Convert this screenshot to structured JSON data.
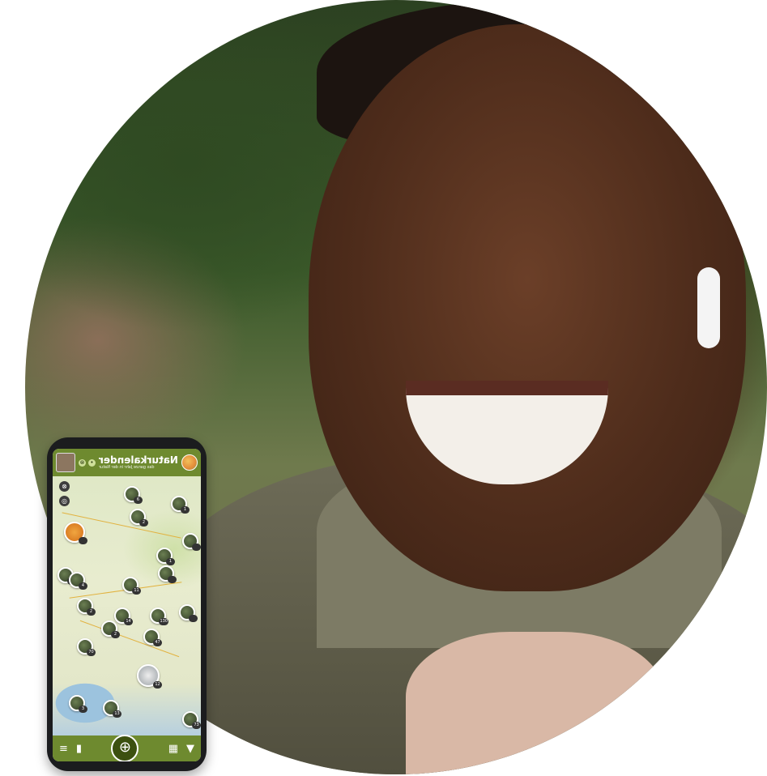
{
  "app": {
    "title": "Naturkalender",
    "subtitle": "das ganze Jahr in der Natur"
  },
  "colors": {
    "brand_green": "#6e8a2f",
    "brand_dark": "#3c5010",
    "phone_body": "#1b1c1e"
  },
  "icons": {
    "menu": "≡",
    "stats": "▮",
    "add": "⊕",
    "grid": "▦",
    "filter": "▼",
    "locate": "◎",
    "binoculars": "⊗",
    "bell": "•"
  },
  "map_markers": [
    {
      "count": "6"
    },
    {
      "count": "1"
    },
    {
      "count": "2"
    },
    {
      "count": ""
    },
    {
      "count": "1"
    },
    {
      "count": "4"
    },
    {
      "count": "4"
    },
    {
      "count": "11"
    },
    {
      "count": "2"
    },
    {
      "count": "14"
    },
    {
      "count": "130"
    },
    {
      "count": ""
    },
    {
      "count": "2"
    },
    {
      "count": "47"
    },
    {
      "count": "70"
    },
    {
      "count": "12"
    },
    {
      "count": "3"
    },
    {
      "count": "13"
    },
    {
      "count": "73"
    },
    {
      "count": ""
    },
    {
      "count": ""
    }
  ]
}
